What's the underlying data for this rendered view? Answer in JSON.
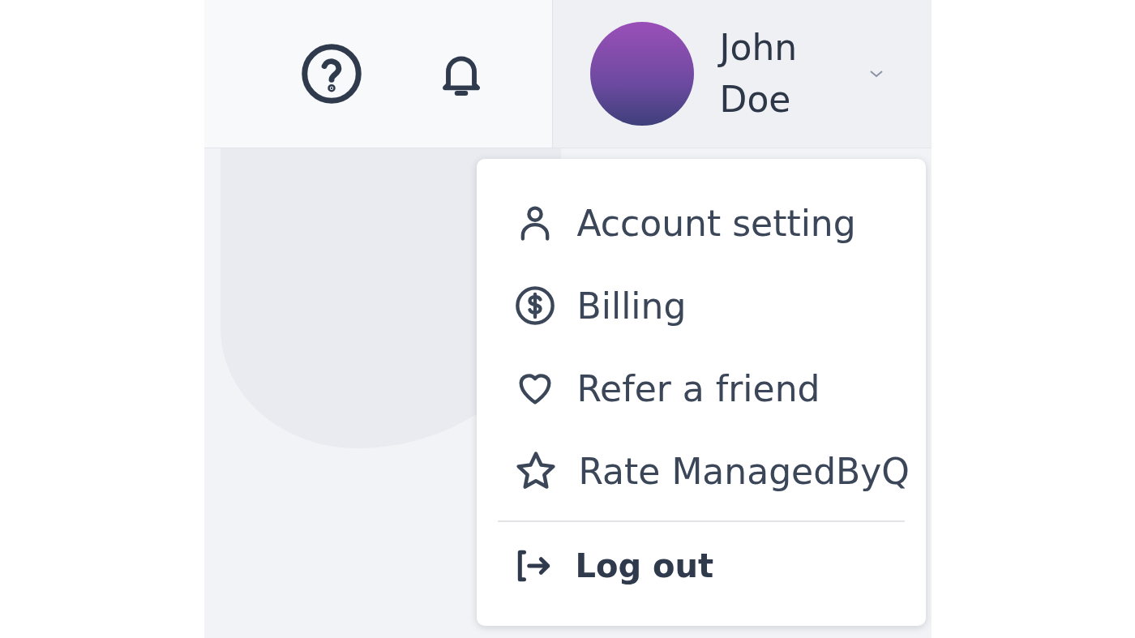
{
  "user": {
    "name": "John Doe",
    "menu_open": true
  },
  "menu": {
    "items": [
      {
        "label": "Account setting"
      },
      {
        "label": "Billing"
      },
      {
        "label": "Refer a friend"
      },
      {
        "label": "Rate ManagedByQ"
      }
    ],
    "logout": {
      "label": "Log out"
    }
  }
}
